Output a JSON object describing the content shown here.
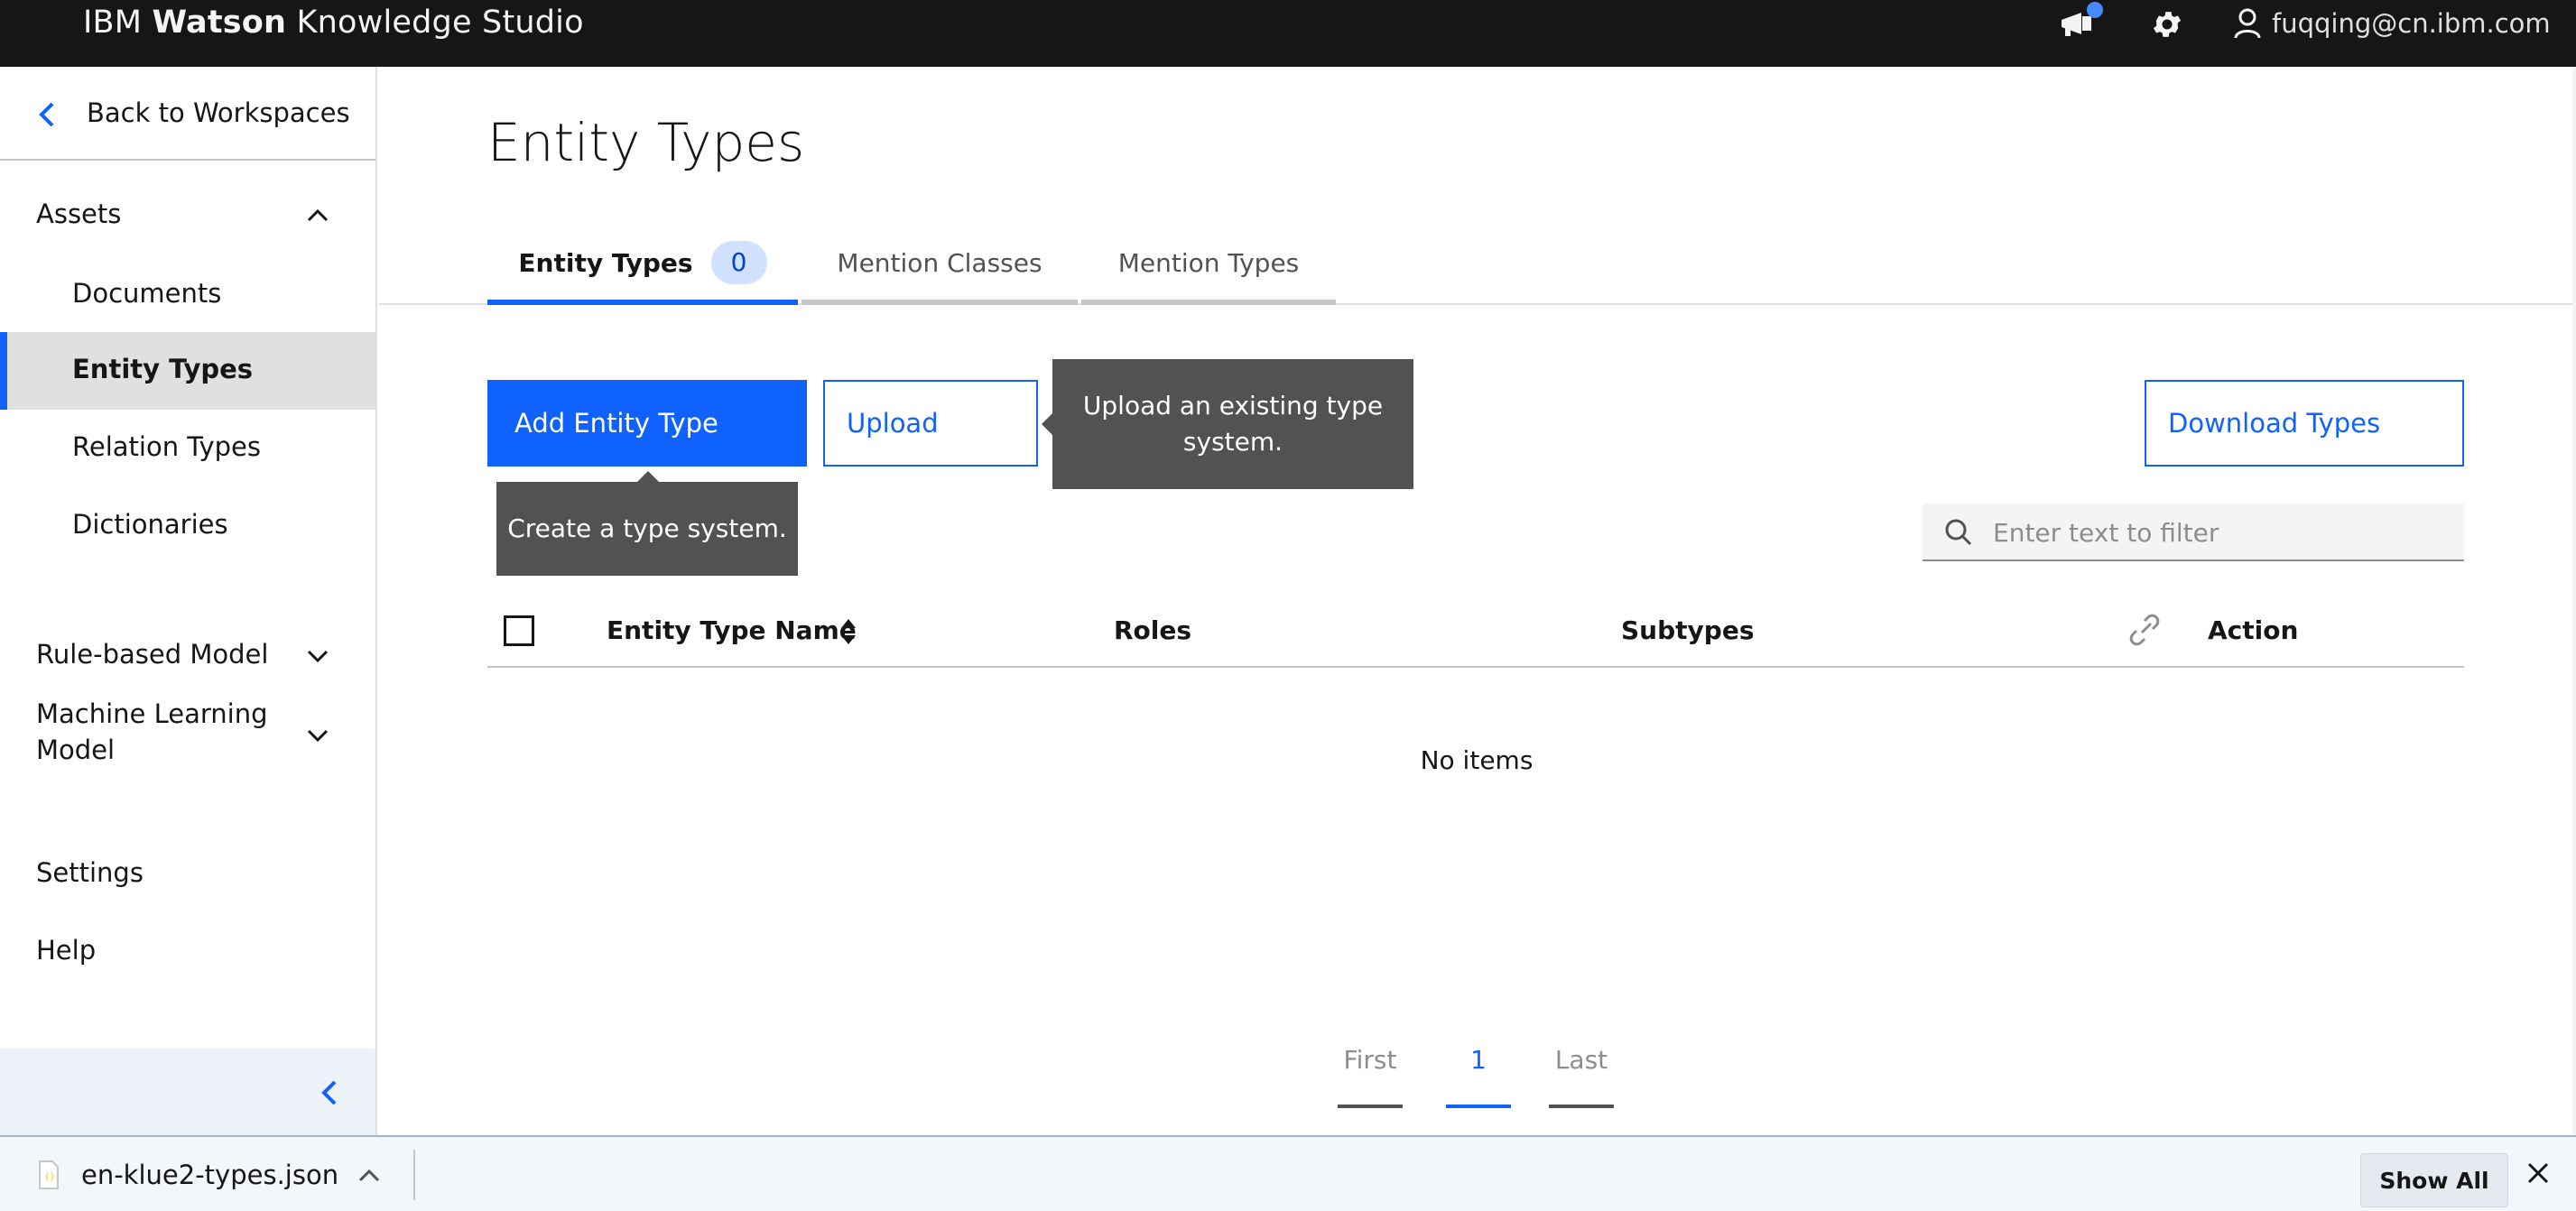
{
  "header": {
    "brand_prefix": "IBM",
    "brand_bold": "Watson",
    "brand_suffix": "Knowledge Studio",
    "user_email": "fuqqing@cn.ibm.com"
  },
  "sidebar": {
    "back_label": "Back to Workspaces",
    "assets_label": "Assets",
    "items": [
      {
        "label": "Documents"
      },
      {
        "label": "Entity Types"
      },
      {
        "label": "Relation Types"
      },
      {
        "label": "Dictionaries"
      }
    ],
    "rule_model_label": "Rule-based Model",
    "ml_model_line1": "Machine Learning",
    "ml_model_line2": "Model",
    "settings_label": "Settings",
    "help_label": "Help"
  },
  "main": {
    "title": "Entity Types",
    "tabs": [
      {
        "label": "Entity Types",
        "count": "0"
      },
      {
        "label": "Mention Classes"
      },
      {
        "label": "Mention Types"
      }
    ],
    "buttons": {
      "add": "Add Entity Type",
      "upload": "Upload",
      "download": "Download Types"
    },
    "tooltips": {
      "add_line1": "Create a type system.",
      "upload_line1": "Upload an existing type",
      "upload_line2": "system."
    },
    "search": {
      "placeholder": "Enter text to filter"
    },
    "table": {
      "columns": [
        "Entity Type Name",
        "Roles",
        "Subtypes",
        "Action"
      ],
      "empty_message": "No items"
    },
    "pagination": {
      "first": "First",
      "current": "1",
      "last": "Last"
    }
  },
  "downloads": {
    "file_name": "en-klue2-types.json",
    "show_all": "Show All"
  },
  "colors": {
    "accent": "#0f62fe",
    "header_bg": "#161616",
    "tooltip_bg": "#525252",
    "badge_bg": "#d0e2ff"
  }
}
